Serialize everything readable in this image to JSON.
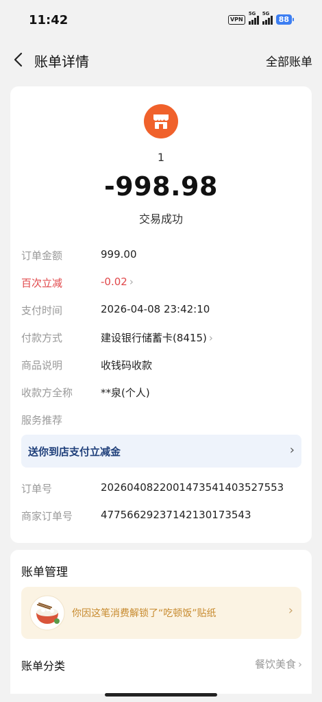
{
  "status_bar": {
    "time": "11:42",
    "vpn": "VPN",
    "signal1": "5G",
    "signal2": "5G",
    "battery": "88"
  },
  "nav": {
    "title": "账单详情",
    "action": "全部账单",
    "back_icon": "chevron-left-icon"
  },
  "summary": {
    "merchant_icon": "shop-icon",
    "merchant_name": "1",
    "amount": "-998.98",
    "status": "交易成功"
  },
  "details": {
    "order_amount": {
      "label": "订单金额",
      "value": "999.00"
    },
    "discount": {
      "label": "百次立减",
      "value": "-0.02",
      "chevron": "›"
    },
    "pay_time": {
      "label": "支付时间",
      "value": "2026-04-08 23:42:10"
    },
    "pay_method": {
      "label": "付款方式",
      "value": "建设银行储蓄卡(8415)",
      "chevron": "›"
    },
    "description": {
      "label": "商品说明",
      "value": "收钱码收款"
    },
    "payee": {
      "label": "收款方全称",
      "value": "**泉(个人)"
    },
    "service": {
      "label": "服务推荐"
    },
    "promo": {
      "text": "送你到店支付立减金",
      "chevron": "›"
    },
    "order_no": {
      "label": "订单号",
      "value": "2026040822001473541403527553"
    },
    "merchant_order_no": {
      "label": "商家订单号",
      "value": "4775662923714213017354​3"
    }
  },
  "manage": {
    "title": "账单管理",
    "sticker_text": "你因这笔消费解锁了“吃顿饭”贴纸",
    "sticker_chevron": "›",
    "category_label": "账单分类",
    "category_value": "餐饮美食",
    "category_chevron": "›"
  },
  "colors": {
    "accent_orange": "#f0612b",
    "discount_red": "#e0474a",
    "promo_blue": "#1f3f7a",
    "sticker_gold": "#c78a2e"
  }
}
